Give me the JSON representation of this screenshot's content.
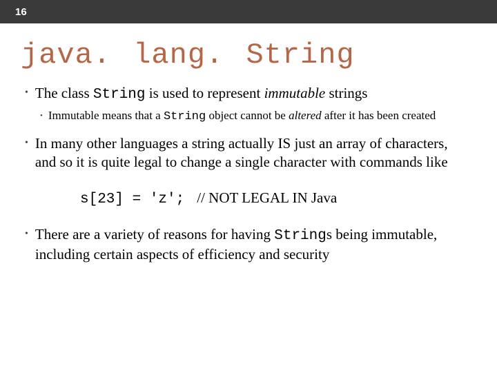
{
  "header": {
    "slide_number": "16"
  },
  "title": "java. lang. String",
  "bullets": {
    "b1": {
      "pre": "The class ",
      "code": "String",
      "mid": " is used to represent ",
      "em": "immutable",
      "post": " strings"
    },
    "b1_1": {
      "pre": "Immutable means that a ",
      "code": "String",
      "mid": " object cannot be ",
      "em": "altered",
      "post": " after it has been created"
    },
    "b2": "In many other languages a string actually IS just an array of characters, and so it is quite legal to change a single character with commands like",
    "code_line": {
      "code": "s[23] = 'z';",
      "comment": "// NOT LEGAL IN Java"
    },
    "b3": {
      "pre": "There are a variety of reasons for having ",
      "code": "String",
      "post": "s being immutable, including certain aspects of efficiency and security"
    }
  }
}
